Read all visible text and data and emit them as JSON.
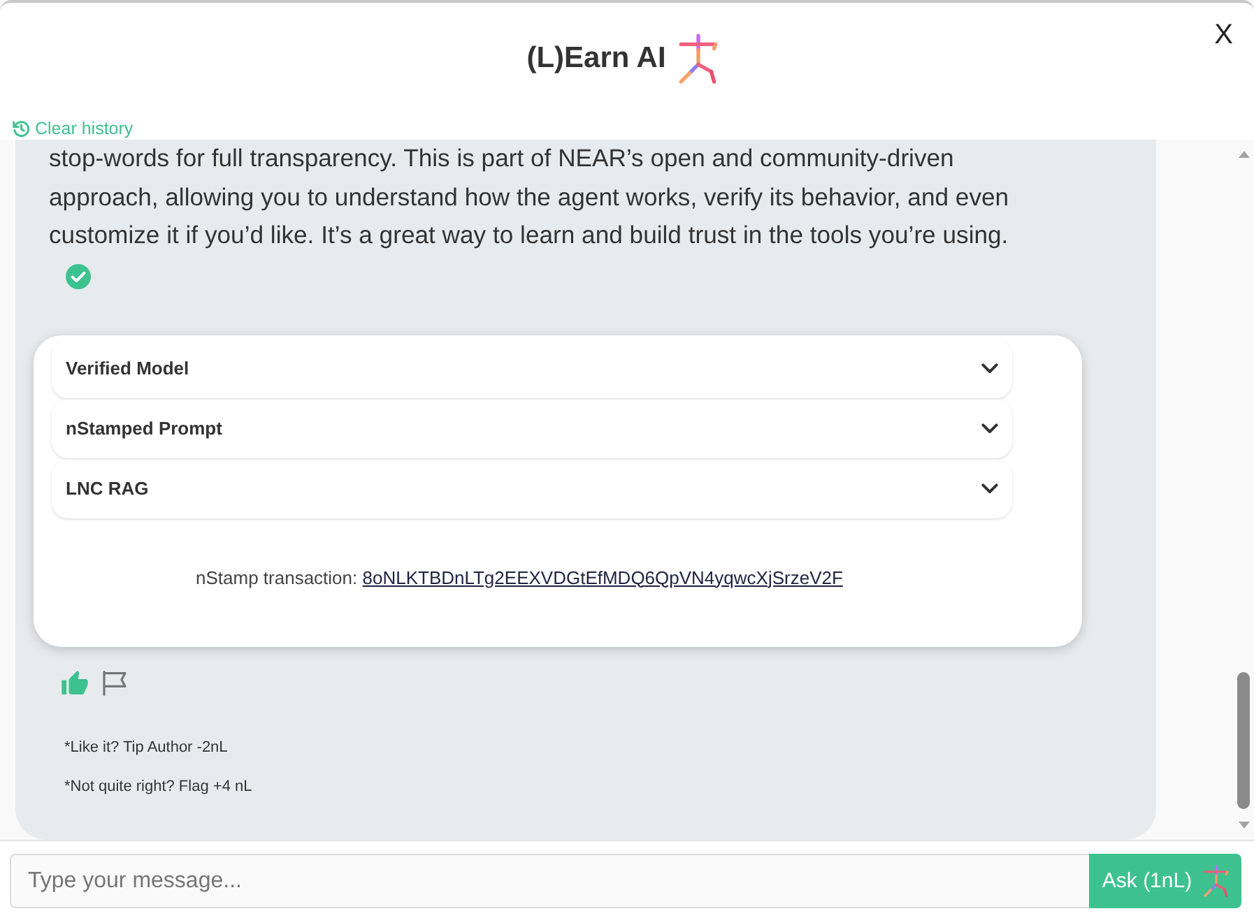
{
  "header": {
    "title": "(L)Earn AI",
    "close_label": "X",
    "clear_history": "Clear history"
  },
  "message": {
    "text": "stop-words for full transparency. This is part of NEAR’s open and community-driven approach, allowing you to understand how the agent works, verify its behavior, and even customize it if you’d like. It’s a great way to learn and build trust in the tools you’re using.",
    "panels": [
      {
        "title": "Verified Model",
        "expanded": false
      },
      {
        "title": "nStamped Prompt",
        "expanded": false
      },
      {
        "title": "LNC RAG",
        "expanded": false
      }
    ],
    "transaction": {
      "label": "nStamp transaction:",
      "hash": "8oNLKTBDnLTg2EEXVDGtEfMDQ6QpVN4yqwcXjSrzeV2F"
    },
    "notes": [
      "*Like it? Tip Author -2nL",
      "*Not quite right? Flag +4 nL"
    ]
  },
  "composer": {
    "placeholder": "Type your message...",
    "button": "Ask (1nL)"
  }
}
